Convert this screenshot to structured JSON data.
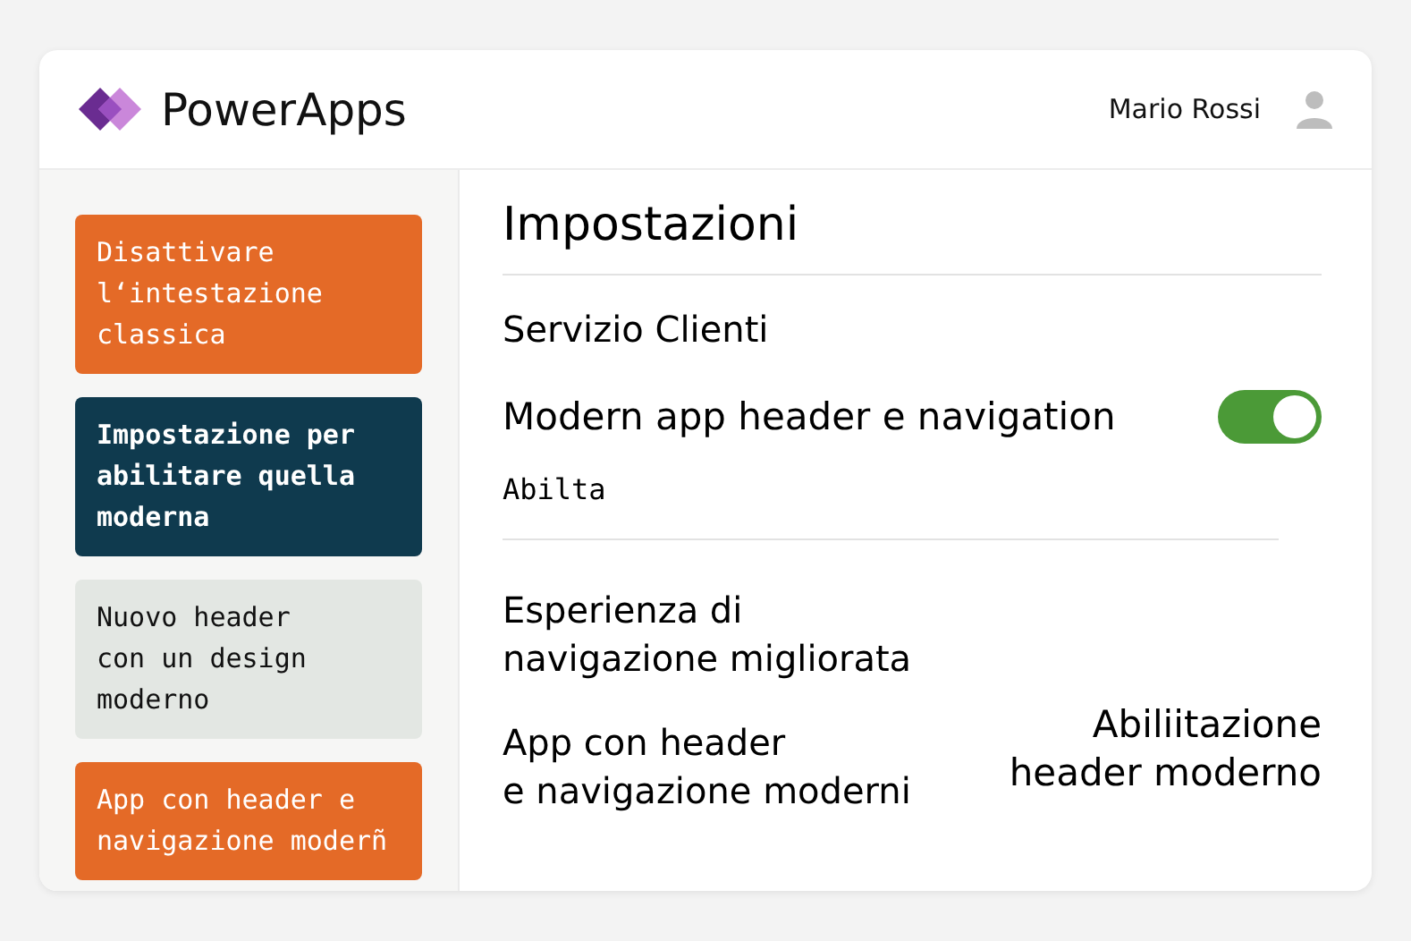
{
  "header": {
    "app_name": "PowerApps",
    "user_name": "Mario Rossi"
  },
  "sidebar": {
    "cards": [
      {
        "kind": "accent",
        "text": "Disattivare\nl‘intestazione\nclassica"
      },
      {
        "kind": "dark",
        "text": "Impostazione per\nabilitare quella\nmoderna"
      },
      {
        "kind": "light",
        "text": "Nuovo header\ncon un design\nmoderno"
      },
      {
        "kind": "accent",
        "text": "App con header e\nnavigazione moderñ"
      }
    ]
  },
  "content": {
    "title": "Impostazioni",
    "section": "Servizio Clienti",
    "setting": {
      "label": "Modern app header e navigation",
      "on": true,
      "caption": "Abilta"
    },
    "description": "Esperienza di\nnavigazione  migliorata",
    "footer_left": "App con header\ne navigazione moderni",
    "footer_right": "Abiliitazione\nheader moderno"
  }
}
